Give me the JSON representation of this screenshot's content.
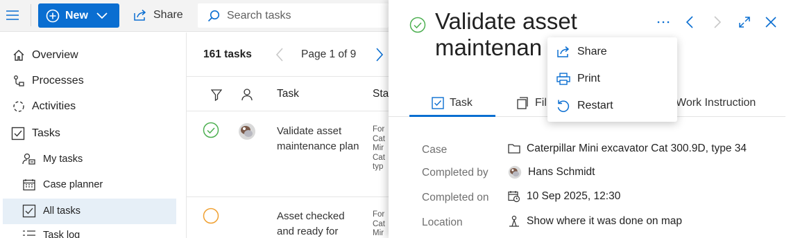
{
  "toolbar": {
    "new_label": "New",
    "share_label": "Share",
    "search_placeholder": "Search tasks"
  },
  "nav": {
    "items": [
      {
        "label": "Overview",
        "icon": "home-icon"
      },
      {
        "label": "Processes",
        "icon": "process-icon"
      },
      {
        "label": "Activities",
        "icon": "activities-icon"
      },
      {
        "label": "Tasks",
        "icon": "checkbox-icon"
      }
    ],
    "sub_items": [
      {
        "label": "My tasks",
        "icon": "my-tasks-icon"
      },
      {
        "label": "Case planner",
        "icon": "calendar-icon"
      },
      {
        "label": "All tasks",
        "icon": "checkbox-icon",
        "active": true
      },
      {
        "label": "Task log",
        "icon": "list-icon"
      }
    ]
  },
  "list": {
    "count": "161 tasks",
    "page": "Page 1 of 9",
    "columns": {
      "task": "Task",
      "status": "Sta"
    },
    "rows": [
      {
        "title": "Validate asset maintenance plan",
        "status_lines": [
          "For",
          "Cat",
          "Mir",
          "Cat",
          "typ"
        ],
        "state": "completed"
      },
      {
        "title": "Asset checked and ready for",
        "status_lines": [
          "For",
          "Cat",
          "Mir"
        ],
        "state": "open"
      }
    ]
  },
  "detail": {
    "title": "Validate asset maintenan",
    "tabs": {
      "task": "Task",
      "files": "Fil",
      "work_instruction": "Work Instruction"
    },
    "props": {
      "case_label": "Case",
      "case_value": "Caterpillar Mini excavator Cat 300.9D, type 34",
      "completed_by_label": "Completed by",
      "completed_by_value": "Hans Schmidt",
      "completed_on_label": "Completed on",
      "completed_on_value": "10 Sep 2025, 12:30",
      "location_label": "Location",
      "location_value": "Show where it was done on map"
    }
  },
  "menu": {
    "share": "Share",
    "print": "Print",
    "restart": "Restart"
  },
  "colors": {
    "accent": "#0a6ed1",
    "completed": "#4caf50",
    "open": "#f0a030"
  }
}
